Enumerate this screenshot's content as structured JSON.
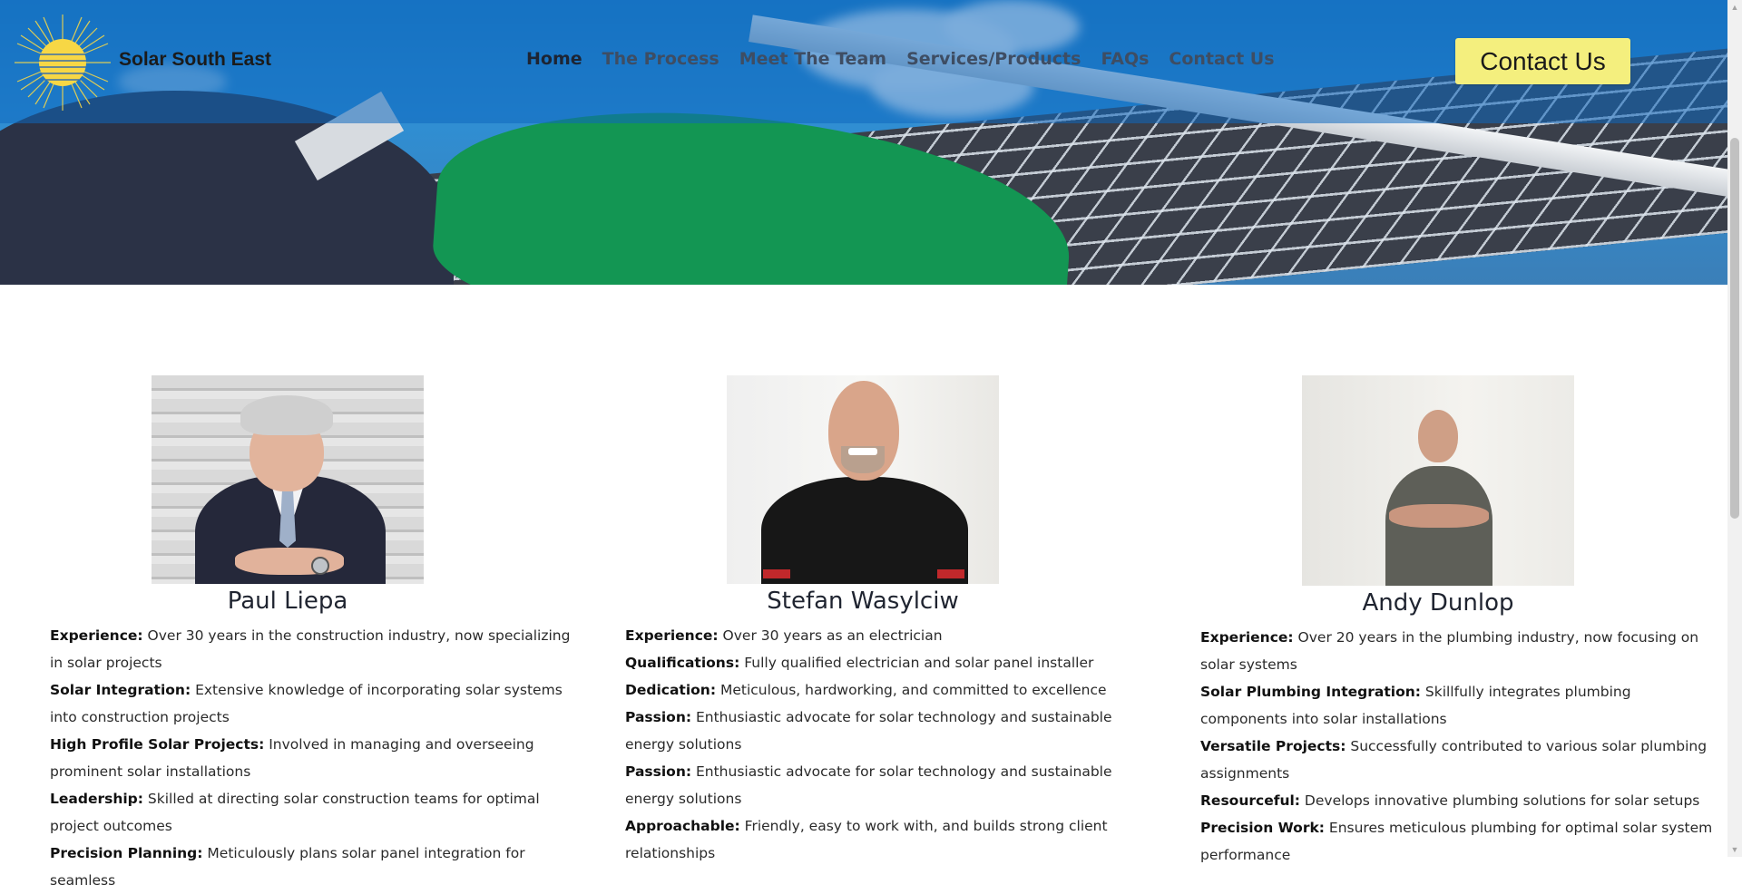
{
  "header": {
    "brand": "Solar South East",
    "nav": [
      {
        "label": "Home",
        "active": true
      },
      {
        "label": "The Process",
        "active": false
      },
      {
        "label": "Meet The Team",
        "active": false
      },
      {
        "label": "Services/Products",
        "active": false
      },
      {
        "label": "FAQs",
        "active": false
      },
      {
        "label": "Contact Us",
        "active": false
      }
    ],
    "cta_label": "Contact Us",
    "cta_color": "#f4ef7e"
  },
  "team": [
    {
      "name": "Paul Liepa",
      "points": [
        {
          "label": "Experience:",
          "text": " Over 30 years in the construction industry, now specializing in solar projects"
        },
        {
          "label": "Solar Integration:",
          "text": " Extensive knowledge of incorporating solar systems into construction projects"
        },
        {
          "label": "High Profile Solar Projects:",
          "text": " Involved in managing and overseeing prominent solar installations"
        },
        {
          "label": "Leadership:",
          "text": " Skilled at directing solar construction teams for optimal project outcomes"
        },
        {
          "label": "Precision Planning:",
          "text": " Meticulously plans solar panel integration for seamless"
        }
      ]
    },
    {
      "name": "Stefan Wasylciw",
      "points": [
        {
          "label": "Experience:",
          "text": " Over 30 years as an electrician"
        },
        {
          "label": "Qualifications:",
          "text": " Fully qualified electrician and solar panel installer"
        },
        {
          "label": "Dedication:",
          "text": " Meticulous, hardworking, and committed to excellence"
        },
        {
          "label": "Passion:",
          "text": " Enthusiastic advocate for solar technology and sustainable energy solutions"
        },
        {
          "label": "Passion:",
          "text": " Enthusiastic advocate for solar technology and sustainable energy solutions"
        },
        {
          "label": "Approachable:",
          "text": " Friendly, easy to work with, and builds strong client relationships"
        }
      ]
    },
    {
      "name": "Andy Dunlop",
      "points": [
        {
          "label": "Experience:",
          "text": " Over 20 years in the plumbing industry, now focusing on solar systems"
        },
        {
          "label": "Solar Plumbing Integration:",
          "text": " Skillfully integrates plumbing components into solar installations"
        },
        {
          "label": "Versatile Projects:",
          "text": " Successfully contributed to various solar plumbing assignments"
        },
        {
          "label": "Resourceful:",
          "text": " Develops innovative plumbing solutions for solar setups"
        },
        {
          "label": "Precision Work:",
          "text": " Ensures meticulous plumbing for optimal solar system performance"
        }
      ]
    }
  ]
}
